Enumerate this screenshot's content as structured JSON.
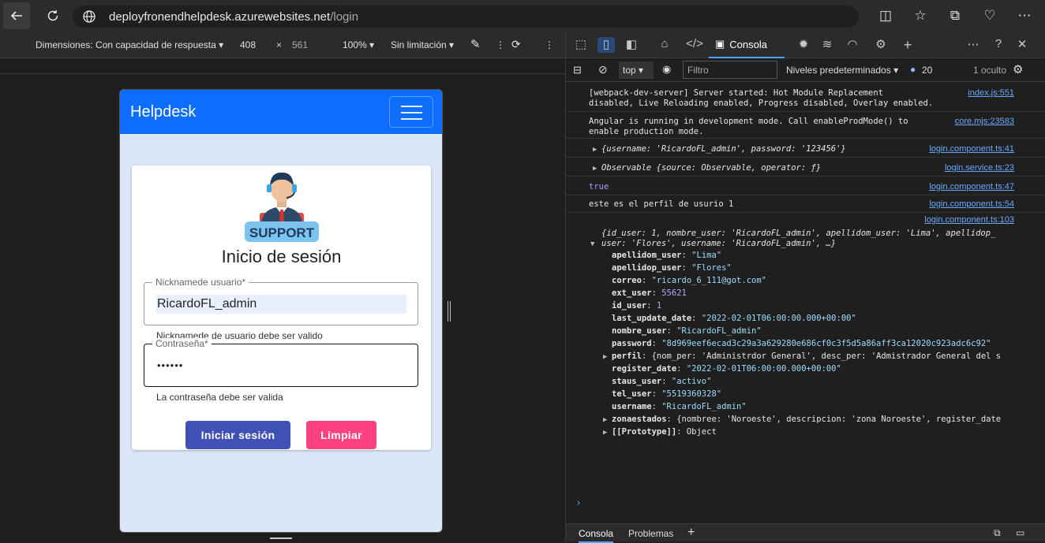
{
  "browser": {
    "url_host": "deployfronendhelpdesk.azurewebsites.net",
    "url_path": "/login"
  },
  "device_toolbar": {
    "dimensions_label": "Dimensiones: Con capacidad de respuesta",
    "width": "408",
    "times": "×",
    "height": "561",
    "zoom": "100%",
    "throttle": "Sin limitación"
  },
  "app": {
    "brand": "Helpdesk",
    "logo_text": "SUPPORT",
    "title": "Inicio de sesión",
    "username": {
      "label": "Nicknamede usuario*",
      "value": "RicardoFL_admin",
      "hint": "Nicknamede de usuario debe ser valido"
    },
    "password": {
      "label": "Contraseña*",
      "value": "••••••",
      "hint": "La contraseña debe ser valida"
    },
    "login_button": "Iniciar sesión",
    "clear_button": "Limpiar",
    "colors": {
      "appbar": "#0d6efd",
      "login": "#3f51b5",
      "clear": "#ff4081",
      "background": "#dbe6f7"
    }
  },
  "devtools": {
    "tab_console": "Consola",
    "context": "top",
    "filter_placeholder": "Filtro",
    "levels": "Niveles predeterminados",
    "issues_count": "20",
    "hidden": "1 oculto",
    "logs": [
      {
        "msg": "[webpack-dev-server] Server started: Hot Module Replacement\ndisabled, Live Reloading enabled, Progress disabled, Overlay enabled.",
        "src": "index.js:551"
      },
      {
        "msg": "Angular is running in development mode. Call enableProdMode() to\nenable production mode.",
        "src": "core.mjs:23583"
      },
      {
        "msg": "{username: 'RicardoFL_admin', password: '123456'}",
        "src": "login.component.ts:41"
      },
      {
        "msg": "Observable {source: Observable, operator: ƒ}",
        "src": "login.service.ts:23"
      },
      {
        "msg": "true",
        "src": "login.component.ts:47"
      },
      {
        "msg": "este es el perfil de usurio 1",
        "src": "login.component.ts:54"
      }
    ],
    "object_log": {
      "src": "login.component.ts:103",
      "summary": "{id_user: 1, nombre_user: 'RicardoFL_admin', apellidom_user: 'Lima', apellidop_\nuser: 'Flores', username: 'RicardoFL_admin', …}",
      "props": [
        {
          "key": "apellidom_user",
          "value": "\"Lima\""
        },
        {
          "key": "apellidop_user",
          "value": "\"Flores\""
        },
        {
          "key": "correo",
          "value": "\"ricardo_6_111@got.com\""
        },
        {
          "key": "ext_user",
          "value": "55621"
        },
        {
          "key": "id_user",
          "value": "1"
        },
        {
          "key": "last_update_date",
          "value": "\"2022-02-01T06:00:00.000+00:00\""
        },
        {
          "key": "nombre_user",
          "value": "\"RicardoFL_admin\""
        },
        {
          "key": "password",
          "value": "\"8d969eef6ecad3c29a3a629280e686cf0c3f5d5a86aff3ca12020c923adc6c92\""
        },
        {
          "key": "perfil",
          "value": "{nom_per: 'Administrdor General', desc_per: 'Admistrador General del s"
        },
        {
          "key": "register_date",
          "value": "\"2022-02-01T06:00:00.000+00:00\""
        },
        {
          "key": "staus_user",
          "value": "\"activo\""
        },
        {
          "key": "tel_user",
          "value": "\"5519360328\""
        },
        {
          "key": "username",
          "value": "\"RicardoFL_admin\""
        },
        {
          "key": "zonaestados",
          "value": "{nombree: 'Noroeste', descripcion: 'zona Noroeste', register_date"
        },
        {
          "key": "[[Prototype]]",
          "value": "Object"
        }
      ]
    },
    "drawer_tab_console": "Consola",
    "drawer_tab_problems": "Problemas"
  }
}
